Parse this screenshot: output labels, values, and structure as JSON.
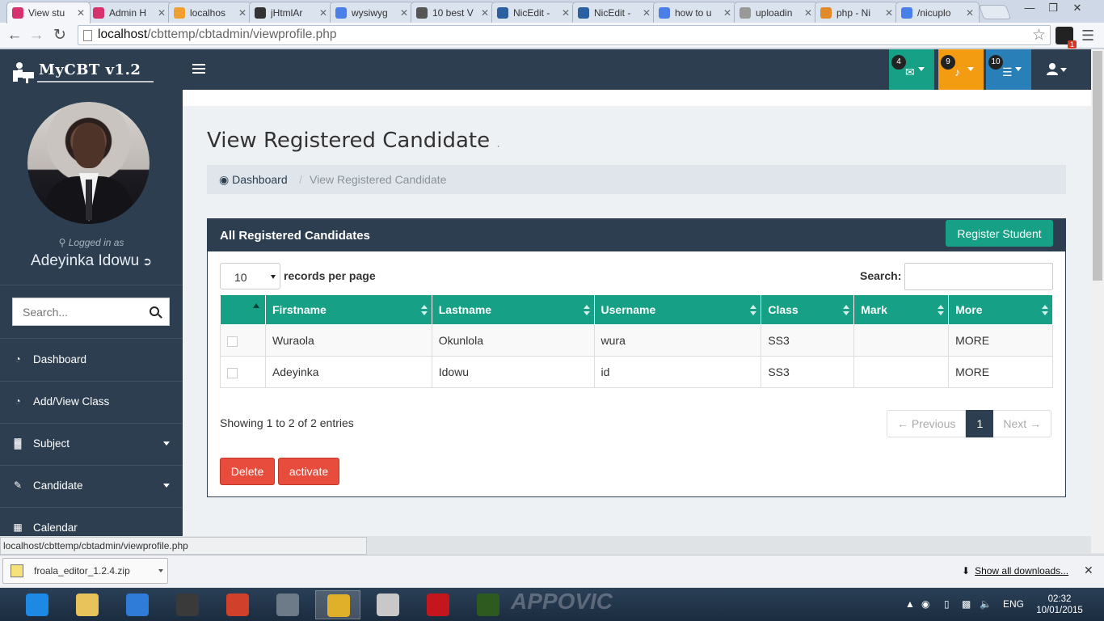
{
  "browser": {
    "tabs": [
      {
        "label": "View stu",
        "icon": "instagram-like-icon",
        "color": "#d6336c",
        "active": true
      },
      {
        "label": "Admin H",
        "icon": "instagram-like-icon",
        "color": "#d6336c"
      },
      {
        "label": "localhos",
        "icon": "phpmyadmin-icon",
        "color": "#f0a030"
      },
      {
        "label": "jHtmlAr",
        "icon": "github-icon",
        "color": "#333333"
      },
      {
        "label": "wysiwyg",
        "icon": "google-icon",
        "color": "#4a7ee8"
      },
      {
        "label": "10 best V",
        "icon": "t-icon",
        "color": "#555555"
      },
      {
        "label": "NicEdit -",
        "icon": "nicedit-icon",
        "color": "#2a5fa0"
      },
      {
        "label": "NicEdit -",
        "icon": "nicedit-icon",
        "color": "#2a5fa0"
      },
      {
        "label": "how to u",
        "icon": "google-icon",
        "color": "#4a7ee8"
      },
      {
        "label": "uploadin",
        "icon": "page-icon",
        "color": "#999999"
      },
      {
        "label": "php - Ni",
        "icon": "stackoverflow-icon",
        "color": "#e08a2a"
      },
      {
        "label": "/nicuplo",
        "icon": "google-icon",
        "color": "#4a7ee8"
      }
    ],
    "url_host": "localhost",
    "url_path": "/cbttemp/cbtadmin/viewprofile.php",
    "extension_badge": "1",
    "status_url": "localhost/cbttemp/cbtadmin/viewprofile.php",
    "download_file": "froala_editor_1.2.4.zip",
    "show_all_downloads": "Show all downloads..."
  },
  "app": {
    "brand": "MyCBT   v1.2",
    "header_buttons": [
      {
        "count": "4",
        "icon": "envelope-icon",
        "color": "#16a085"
      },
      {
        "count": "9",
        "icon": "bell-icon",
        "color": "#f39c12"
      },
      {
        "count": "10",
        "icon": "tasks-icon",
        "color": "#2980b9"
      }
    ]
  },
  "sidebar": {
    "logged_in_label": "Logged in as",
    "user_name": "Adeyinka Idowu",
    "search_placeholder": "Search...",
    "items": [
      {
        "label": "Dashboard",
        "icon": "dashboard-icon",
        "has_caret": false
      },
      {
        "label": "Add/View Class",
        "icon": "dashboard-icon",
        "has_caret": false
      },
      {
        "label": "Subject",
        "icon": "bar-chart-icon",
        "has_caret": true
      },
      {
        "label": "Candidate",
        "icon": "edit-icon",
        "has_caret": true
      },
      {
        "label": "Calendar",
        "icon": "calendar-icon",
        "has_caret": false
      }
    ]
  },
  "main": {
    "page_title": "View Registered Candidate",
    "page_title_suffix": ".",
    "breadcrumb": {
      "home": "Dashboard",
      "separator": "/",
      "current": "View Registered Candidate"
    },
    "panel_title": "All Registered Candidates",
    "register_button": "Register Student",
    "records_per_page_value": "10",
    "records_per_page_label": "records per page",
    "search_label": "Search:",
    "table": {
      "columns": [
        "",
        "Firstname",
        "Lastname",
        "Username",
        "Class",
        "Mark",
        "More"
      ],
      "rows": [
        {
          "firstname": "Wuraola",
          "lastname": "Okunlola",
          "username": "wura",
          "class": "SS3",
          "mark": "",
          "more": "MORE"
        },
        {
          "firstname": "Adeyinka",
          "lastname": "Idowu",
          "username": "id",
          "class": "SS3",
          "mark": "",
          "more": "MORE"
        }
      ]
    },
    "showing_text": "Showing 1 to 2 of 2 entries",
    "pager": {
      "previous": "← Previous",
      "current": "1",
      "next": "Next →"
    },
    "delete_button": "Delete",
    "activate_button": "activate"
  },
  "taskbar": {
    "language": "ENG",
    "time": "02:32",
    "date": "10/01/2015",
    "apps": [
      {
        "icon": "ie-icon",
        "color": "#1e88e5"
      },
      {
        "icon": "folder-icon",
        "color": "#e8c25a"
      },
      {
        "icon": "rocket-icon",
        "color": "#2f7bd8"
      },
      {
        "icon": "camera-app-icon",
        "color": "#3a3a3a"
      },
      {
        "icon": "puzzle-icon",
        "color": "#d0402a"
      },
      {
        "icon": "hp-icon",
        "color": "#6d7b88"
      },
      {
        "icon": "chrome-icon",
        "color": "#e0b02a"
      },
      {
        "icon": "reader-icon",
        "color": "#c8c8c8"
      },
      {
        "icon": "adobe-reader-icon",
        "color": "#c4161c"
      },
      {
        "icon": "dreamweaver-icon",
        "color": "#2d5a1e"
      }
    ]
  }
}
